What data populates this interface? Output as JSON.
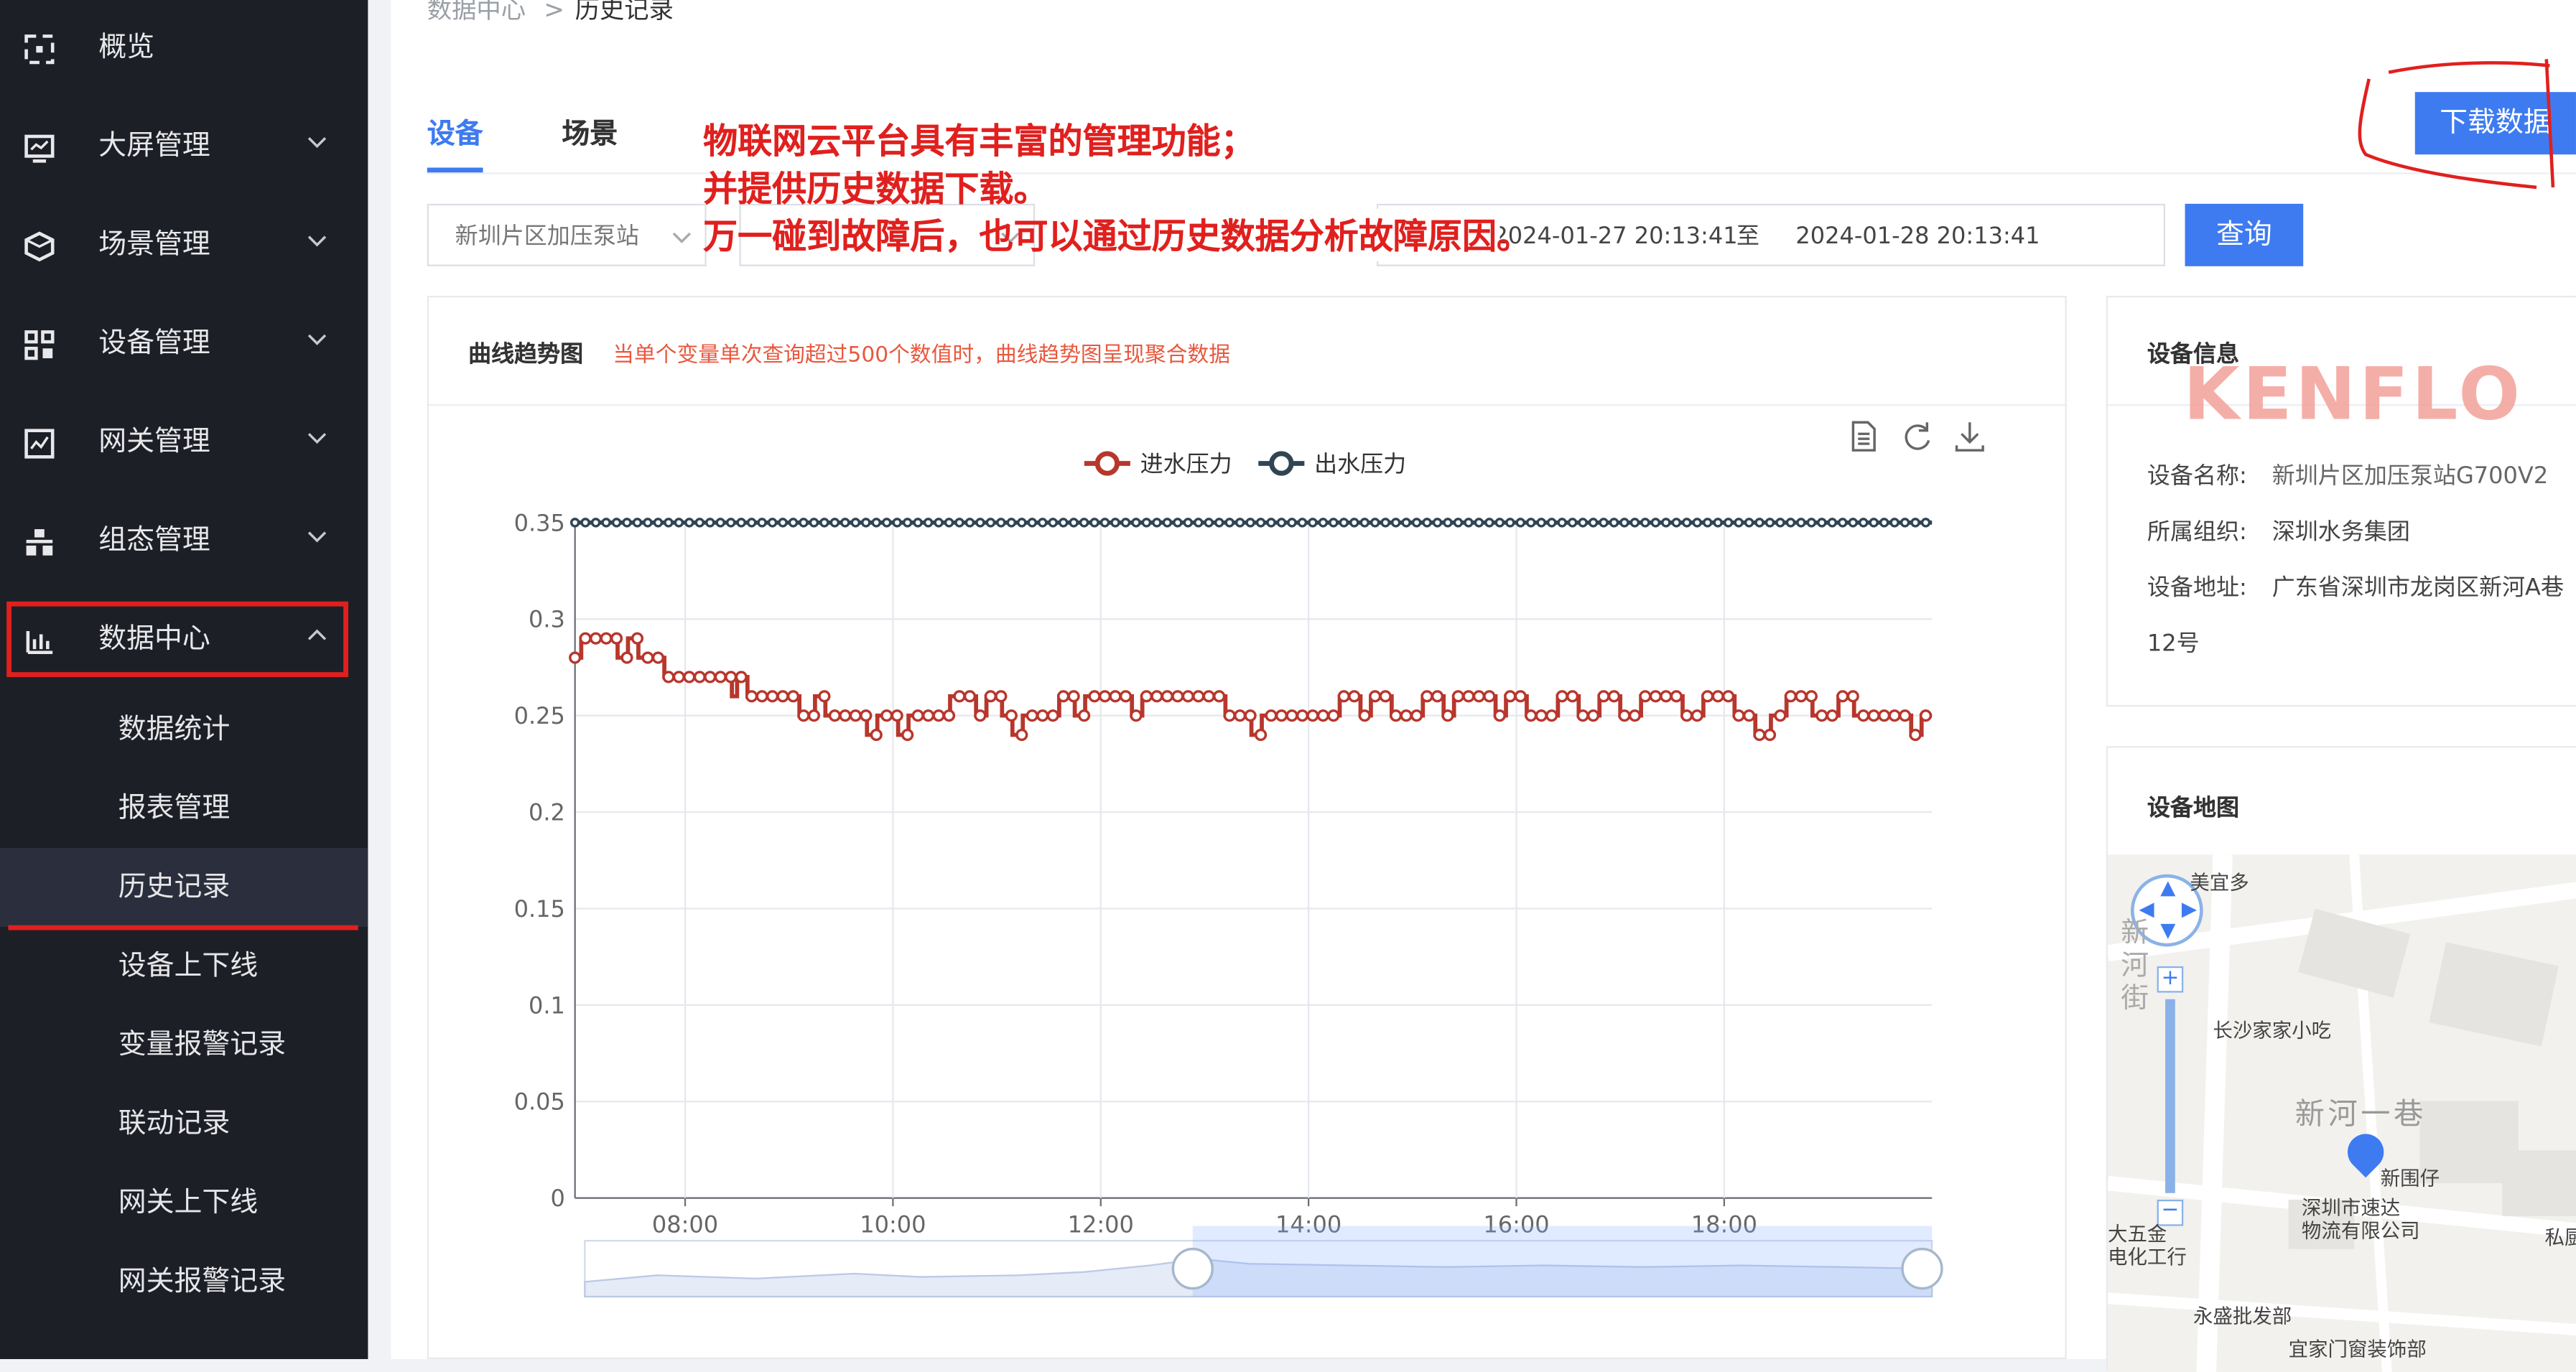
{
  "sidebar": {
    "items": [
      {
        "label": "概览",
        "icon": "scan-icon",
        "top": 0,
        "chevron": false
      },
      {
        "label": "大屏管理",
        "icon": "monitor-icon",
        "top": 60,
        "chevron": true
      },
      {
        "label": "场景管理",
        "icon": "cube-icon",
        "top": 120,
        "chevron": true
      },
      {
        "label": "设备管理",
        "icon": "grid-icon",
        "top": 180,
        "chevron": true
      },
      {
        "label": "网关管理",
        "icon": "gateway-chart-icon",
        "top": 240,
        "chevron": true
      },
      {
        "label": "组态管理",
        "icon": "org-icon",
        "top": 300,
        "chevron": true
      },
      {
        "label": "数据中心",
        "icon": "bar-chart-icon",
        "top": 360,
        "chevron": true
      }
    ],
    "subitems": [
      "数据统计",
      "报表管理",
      "历史记录",
      "设备上下线",
      "变量报警记录",
      "联动记录",
      "网关上下线",
      "网关报警记录"
    ],
    "active_subitem": "历史记录"
  },
  "breadcrumb": {
    "parent": "数据中心",
    "separator": ">",
    "current": "历史记录"
  },
  "tabs": [
    {
      "label": "设备",
      "active": true
    },
    {
      "label": "场景",
      "active": false
    }
  ],
  "annotation": {
    "line1": "物联网云平台具有丰富的管理功能；",
    "line2": "并提供历史数据下载。",
    "line3": "万一碰到故障后，也可以通过历史数据分析故障原因。"
  },
  "download_button": "下载数据",
  "filters": {
    "device_select": "新圳片区加压泵站",
    "start_time": "2024-01-27 20:13:41",
    "range_separator": "至",
    "end_time": "2024-01-28 20:13:41",
    "query_button": "查询"
  },
  "chart_panel": {
    "title": "曲线趋势图",
    "notice": "当单个变量单次查询超过500个数值时，曲线趋势图呈现聚合数据",
    "toolbox_icons": [
      "data-view-icon",
      "restore-icon",
      "save-image-icon"
    ]
  },
  "chart_data": {
    "type": "line",
    "legend": [
      "进水压力",
      "出水压力"
    ],
    "colors": [
      "#b8362c",
      "#2f4554"
    ],
    "yticks": [
      "0.35",
      "0.3",
      "0.25",
      "0.2",
      "0.15",
      "0.1",
      "0.05",
      "0"
    ],
    "ylim": [
      0,
      0.35
    ],
    "xticks": [
      "08:00",
      "10:00",
      "12:00",
      "14:00",
      "16:00",
      "18:00"
    ],
    "xrange_hours": [
      6.94,
      20.0
    ],
    "series": [
      {
        "name": "进水压力",
        "points": [
          [
            6.94,
            0.28
          ],
          [
            7.0,
            0.29
          ],
          [
            7.3,
            0.29
          ],
          [
            7.35,
            0.28
          ],
          [
            7.45,
            0.29
          ],
          [
            7.55,
            0.28
          ],
          [
            7.7,
            0.28
          ],
          [
            7.8,
            0.27
          ],
          [
            8.4,
            0.27
          ],
          [
            8.45,
            0.26
          ],
          [
            8.5,
            0.27
          ],
          [
            8.6,
            0.26
          ],
          [
            9.05,
            0.26
          ],
          [
            9.1,
            0.25
          ],
          [
            9.25,
            0.26
          ],
          [
            9.35,
            0.25
          ],
          [
            9.6,
            0.25
          ],
          [
            9.75,
            0.24
          ],
          [
            9.85,
            0.25
          ],
          [
            10.0,
            0.25
          ],
          [
            10.05,
            0.24
          ],
          [
            10.15,
            0.25
          ],
          [
            10.5,
            0.25
          ],
          [
            10.55,
            0.26
          ],
          [
            10.8,
            0.25
          ],
          [
            10.9,
            0.26
          ],
          [
            11.05,
            0.25
          ],
          [
            11.15,
            0.24
          ],
          [
            11.25,
            0.25
          ],
          [
            11.5,
            0.25
          ],
          [
            11.6,
            0.26
          ],
          [
            11.75,
            0.25
          ],
          [
            11.85,
            0.26
          ],
          [
            12.2,
            0.26
          ],
          [
            12.3,
            0.25
          ],
          [
            12.4,
            0.26
          ],
          [
            13.1,
            0.26
          ],
          [
            13.2,
            0.25
          ],
          [
            13.35,
            0.25
          ],
          [
            13.45,
            0.24
          ],
          [
            13.55,
            0.25
          ],
          [
            14.2,
            0.25
          ],
          [
            14.3,
            0.26
          ],
          [
            14.5,
            0.25
          ],
          [
            14.6,
            0.26
          ],
          [
            14.8,
            0.25
          ],
          [
            15.0,
            0.25
          ],
          [
            15.1,
            0.26
          ],
          [
            15.3,
            0.25
          ],
          [
            15.4,
            0.26
          ],
          [
            15.7,
            0.26
          ],
          [
            15.8,
            0.25
          ],
          [
            15.9,
            0.26
          ],
          [
            16.1,
            0.25
          ],
          [
            16.3,
            0.25
          ],
          [
            16.4,
            0.26
          ],
          [
            16.6,
            0.25
          ],
          [
            16.8,
            0.26
          ],
          [
            17.0,
            0.25
          ],
          [
            17.2,
            0.26
          ],
          [
            17.5,
            0.26
          ],
          [
            17.6,
            0.25
          ],
          [
            17.8,
            0.26
          ],
          [
            18.1,
            0.25
          ],
          [
            18.3,
            0.24
          ],
          [
            18.45,
            0.25
          ],
          [
            18.6,
            0.26
          ],
          [
            18.8,
            0.26
          ],
          [
            18.85,
            0.25
          ],
          [
            19.0,
            0.25
          ],
          [
            19.1,
            0.26
          ],
          [
            19.25,
            0.25
          ],
          [
            19.35,
            0.25
          ],
          [
            19.5,
            0.25
          ],
          [
            19.7,
            0.25
          ],
          [
            19.8,
            0.24
          ],
          [
            19.9,
            0.25
          ],
          [
            20.0,
            0.25
          ]
        ]
      },
      {
        "name": "出水压力",
        "points": [
          [
            6.94,
            0.35
          ],
          [
            20.0,
            0.35
          ]
        ]
      }
    ]
  },
  "device_info": {
    "title": "设备信息",
    "watermark": "KENFLO",
    "name_label": "设备名称:",
    "name_value": "新圳片区加压泵站G700V2",
    "org_label": "所属组织:",
    "org_value": "深圳水务集团",
    "addr_label": "设备地址:",
    "addr_value": "广东省深圳市龙岗区新河A巷",
    "addr_value2": "12号"
  },
  "device_map": {
    "title": "设备地图",
    "labels": {
      "meiyi": "美宜多",
      "xinhejie": "新河街",
      "changsha": "长沙家家小吃",
      "xinheyixiang": "新河一巷",
      "xinweizai": "新围仔",
      "sudi1": "深圳市速达",
      "sudi2": "物流有限公司",
      "dawujin1": "大五金",
      "dawujin2": "电化工行",
      "yongsheng": "永盛批发部",
      "yijia": "宜家门窗装饰部",
      "sicai": "私厨"
    }
  }
}
